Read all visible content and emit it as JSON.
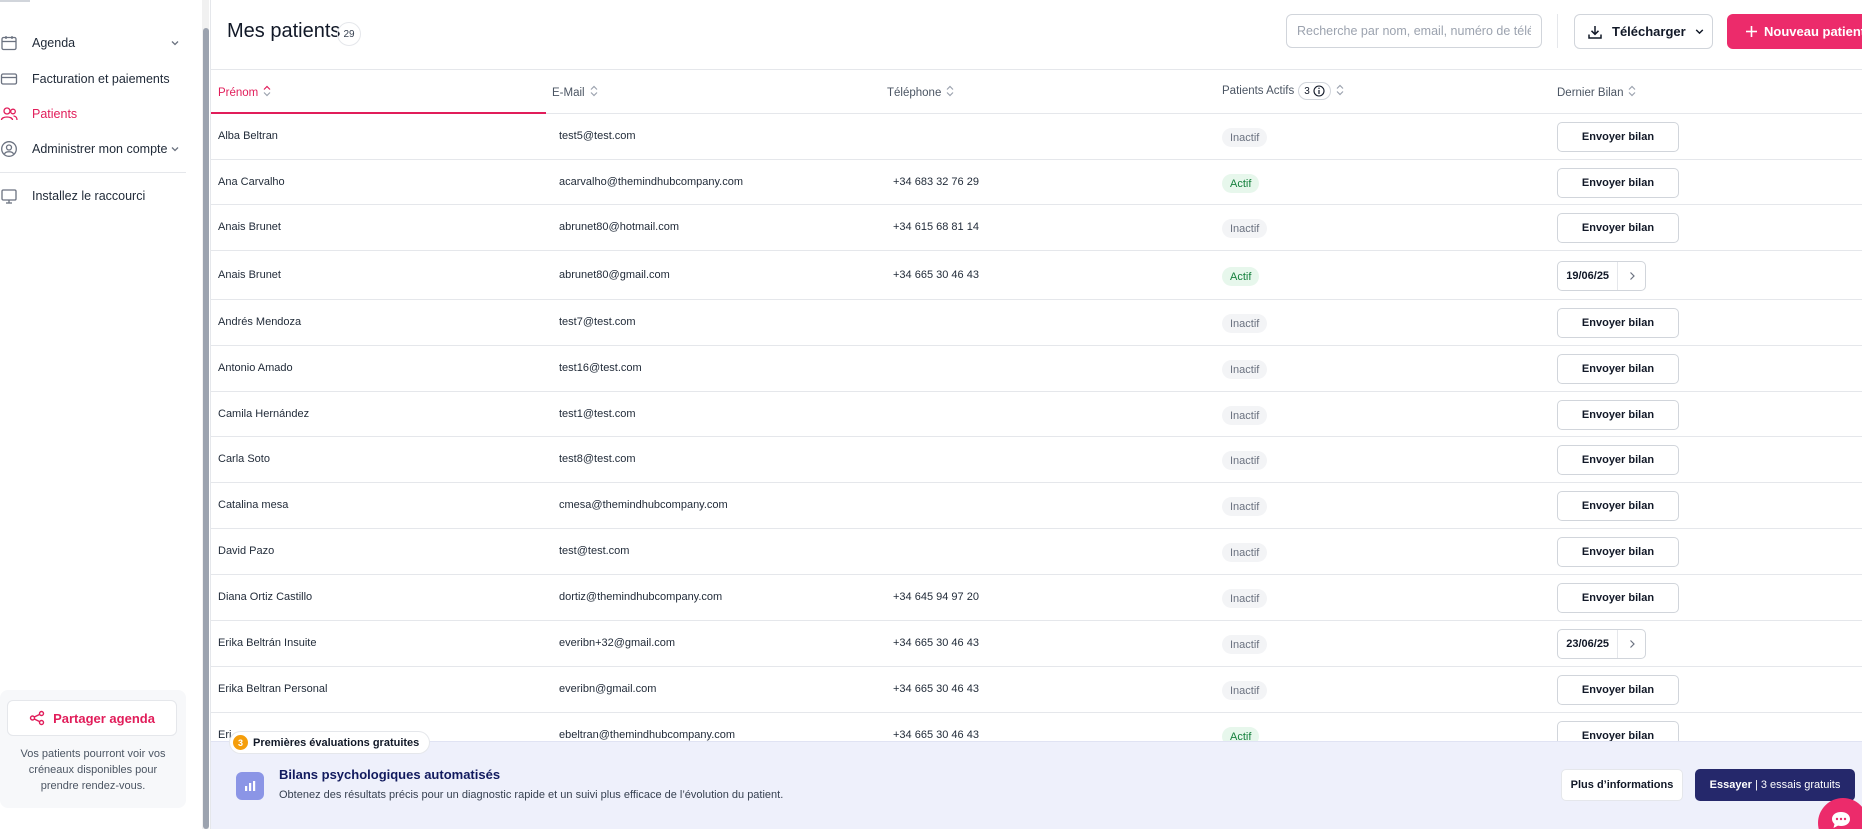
{
  "sidebar": {
    "items": [
      {
        "label": "Agenda",
        "icon": "calendar-icon",
        "has_chevron": true
      },
      {
        "label": "Facturation et paiements",
        "icon": "billing-icon",
        "has_chevron": false
      },
      {
        "label": "Patients",
        "icon": "patients-icon",
        "has_chevron": false,
        "active": true
      },
      {
        "label": "Administrer mon compte",
        "icon": "account-icon",
        "has_chevron": true
      },
      {
        "label": "Installez le raccourci",
        "icon": "monitor-icon",
        "has_chevron": false
      }
    ],
    "share": {
      "button_label": "Partager agenda",
      "text": "Vos patients pourront voir vos créneaux disponibles pour prendre rendez-vous."
    }
  },
  "header": {
    "title": "Mes patients",
    "count": "29",
    "search_placeholder": "Recherche par nom, email, numéro de télé",
    "download_label": "Télécharger",
    "new_patient_label": "Nouveau patient"
  },
  "table": {
    "columns": {
      "name": "Prénom",
      "email": "E-Mail",
      "phone": "Téléphone",
      "active": "Patients Actifs",
      "active_count": "3",
      "last": "Dernier Bilan"
    },
    "rows": [
      {
        "name": "Alba Beltran",
        "email": "test5@test.com",
        "phone": "",
        "status": "Inactif",
        "bilan": "Envoyer bilan"
      },
      {
        "name": "Ana Carvalho",
        "email": "acarvalho@themindhubcompany.com",
        "phone": "+34 683 32 76 29",
        "status": "Actif",
        "bilan": "Envoyer bilan"
      },
      {
        "name": "Anais Brunet",
        "email": "abrunet80@hotmail.com",
        "phone": "+34 615 68 81 14",
        "status": "Inactif",
        "bilan": "Envoyer bilan"
      },
      {
        "name": "Anais Brunet",
        "email": "abrunet80@gmail.com",
        "phone": "+34 665 30 46 43",
        "status": "Actif",
        "bilan_date": "19/06/25"
      },
      {
        "name": "Andrés Mendoza",
        "email": "test7@test.com",
        "phone": "",
        "status": "Inactif",
        "bilan": "Envoyer bilan"
      },
      {
        "name": "Antonio Amado",
        "email": "test16@test.com",
        "phone": "",
        "status": "Inactif",
        "bilan": "Envoyer bilan"
      },
      {
        "name": "Camila Hernández",
        "email": "test1@test.com",
        "phone": "",
        "status": "Inactif",
        "bilan": "Envoyer bilan"
      },
      {
        "name": "Carla Soto",
        "email": "test8@test.com",
        "phone": "",
        "status": "Inactif",
        "bilan": "Envoyer bilan"
      },
      {
        "name": "Catalina mesa",
        "email": "cmesa@themindhubcompany.com",
        "phone": "",
        "status": "Inactif",
        "bilan": "Envoyer bilan"
      },
      {
        "name": "David Pazo",
        "email": "test@test.com",
        "phone": "",
        "status": "Inactif",
        "bilan": "Envoyer bilan"
      },
      {
        "name": "Diana Ortiz Castillo",
        "email": "dortiz@themindhubcompany.com",
        "phone": "+34 645 94 97 20",
        "status": "Inactif",
        "bilan": "Envoyer bilan"
      },
      {
        "name": "Erika Beltrán Insuite",
        "email": "everibn+32@gmail.com",
        "phone": "+34 665 30 46 43",
        "status": "Inactif",
        "bilan_date": "23/06/25"
      },
      {
        "name": "Erika Beltran Personal",
        "email": "everibn@gmail.com",
        "phone": "+34 665 30 46 43",
        "status": "Inactif",
        "bilan": "Envoyer bilan"
      },
      {
        "name": "Eri",
        "email": "ebeltran@themindhubcompany.com",
        "phone": "+34 665 30 46 43",
        "status": "Actif",
        "bilan": "Envoyer bilan"
      }
    ]
  },
  "promo": {
    "tag_number": "3",
    "tag_label": "Premières évaluations gratuites",
    "title": "Bilans psychologiques automatisés",
    "description": "Obtenez des résultats précis pour un diagnostic rapide et un suivi plus efficace de l’évolution du patient.",
    "more_label": "Plus d’informations",
    "try_label": "Essayer",
    "try_suffix": "| 3 essais gratuits"
  },
  "colors": {
    "accent": "#ec2b6b",
    "active_text": "#e11d5a",
    "navy": "#25286b",
    "status_active": "#15803d"
  }
}
